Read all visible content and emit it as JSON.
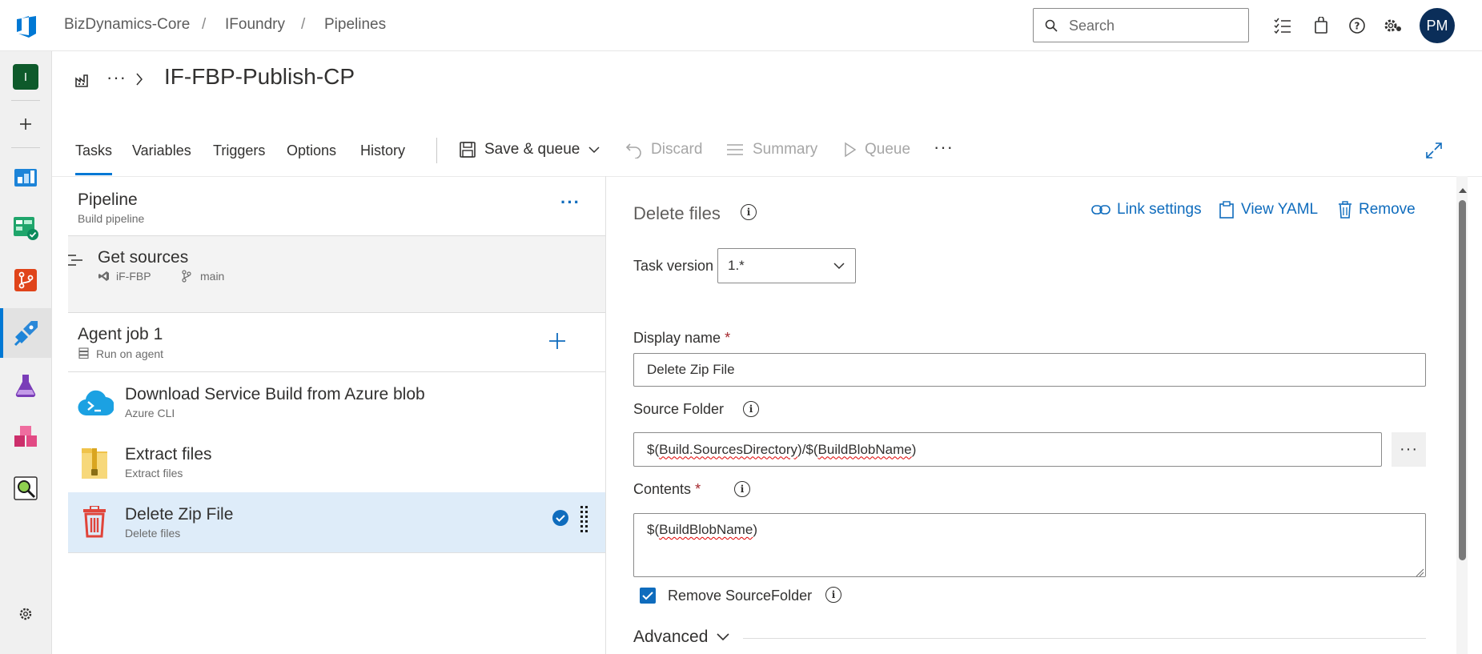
{
  "breadcrumb": {
    "org": "BizDynamics-Core",
    "project": "IFoundry",
    "section": "Pipelines"
  },
  "search": {
    "placeholder": "Search"
  },
  "user": {
    "initials": "PM"
  },
  "rail": {
    "project_initial": "I"
  },
  "pipeline_title": "IF-FBP-Publish-CP",
  "tabs": [
    "Tasks",
    "Variables",
    "Triggers",
    "Options",
    "History"
  ],
  "toolbar": {
    "save_queue": "Save & queue",
    "discard": "Discard",
    "summary": "Summary",
    "queue": "Queue",
    "more": "···"
  },
  "left": {
    "pipeline": {
      "title": "Pipeline",
      "subtitle": "Build pipeline",
      "more": "···"
    },
    "get_sources": {
      "title": "Get sources",
      "repo": "iF-FBP",
      "branch": "main"
    },
    "agent_job": {
      "title": "Agent job 1",
      "subtitle": "Run on agent"
    },
    "tasks": [
      {
        "title": "Download Service Build from Azure blob",
        "subtitle": "Azure CLI"
      },
      {
        "title": "Extract files",
        "subtitle": "Extract files"
      },
      {
        "title": "Delete Zip File",
        "subtitle": "Delete files"
      }
    ]
  },
  "right": {
    "heading": "Delete files",
    "link_settings": "Link settings",
    "view_yaml": "View YAML",
    "remove": "Remove",
    "task_version_label": "Task version",
    "task_version_value": "1.*",
    "display_name_label": "Display name",
    "display_name_value": "Delete Zip File",
    "source_folder_label": "Source Folder",
    "source_folder_value_prefix": "$(",
    "source_folder_value_var1": "Build.SourcesDirectory",
    "source_folder_value_mid": ")/$(",
    "source_folder_value_var2": "BuildBlobName",
    "source_folder_value_suffix": ")",
    "browse": "···",
    "contents_label": "Contents",
    "contents_prefix": "$(",
    "contents_var": "BuildBlobName",
    "contents_suffix": ")",
    "required_mark": "*",
    "remove_source_folder_label": "Remove SourceFolder",
    "advanced_label": "Advanced"
  },
  "colors": {
    "accent": "#0078d4",
    "selected_row": "#deecf9",
    "link": "#0f6cbd"
  }
}
